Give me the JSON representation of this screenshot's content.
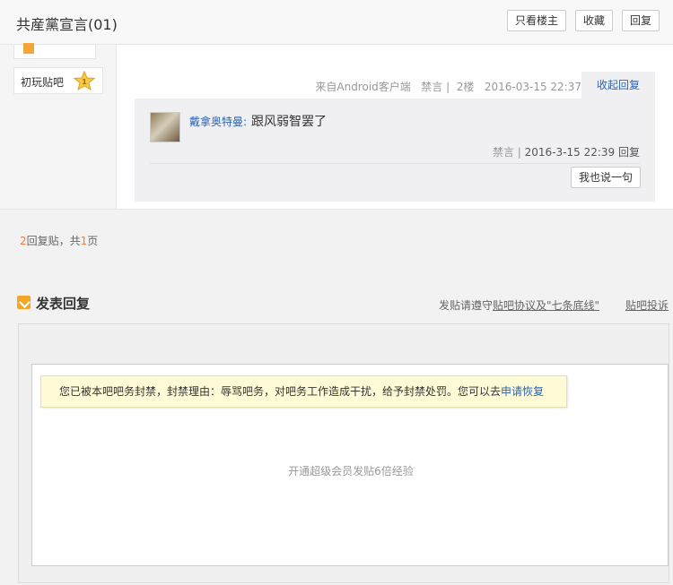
{
  "header": {
    "title": "共産黨宣言(01)",
    "buttons": {
      "louzhu": "只看楼主",
      "fav": "收藏",
      "reply": "回复"
    }
  },
  "author": {
    "level_name": "初玩贴吧",
    "level_num": "1"
  },
  "post": {
    "src_prefix": "来自",
    "src_link": "Android客户端",
    "ban": "禁言",
    "sep": "|",
    "floor": "2楼",
    "time": "2016-03-15 22:37",
    "collapse": "收起回复"
  },
  "lzl": {
    "user": "戴拿奥特曼",
    "colon": ":",
    "text": "跟风弱智罢了",
    "ban": "禁言",
    "sep": "|",
    "time": "2016-3-15 22:39",
    "reply": "回复",
    "say": "我也说一句"
  },
  "pager": {
    "count": "2",
    "label1": "回复贴，共",
    "pages": "1",
    "label2": "页"
  },
  "reply": {
    "title": "发表回复",
    "rules_prefix": "发贴请遵守",
    "rules_link": "贴吧协议及\"七条底线\"",
    "complain": "贴吧投诉",
    "ban_msg": "您已被本吧吧务封禁，封禁理由：辱骂吧务，对吧务工作造成干扰，给予封禁处罚。您可以去",
    "ban_link": "申请恢复",
    "vip": "开通超级会员发贴6倍经验"
  },
  "colors": {
    "link": "#2d64b3",
    "accent": "#f57c3a",
    "ban_bg": "#fffbd6"
  }
}
